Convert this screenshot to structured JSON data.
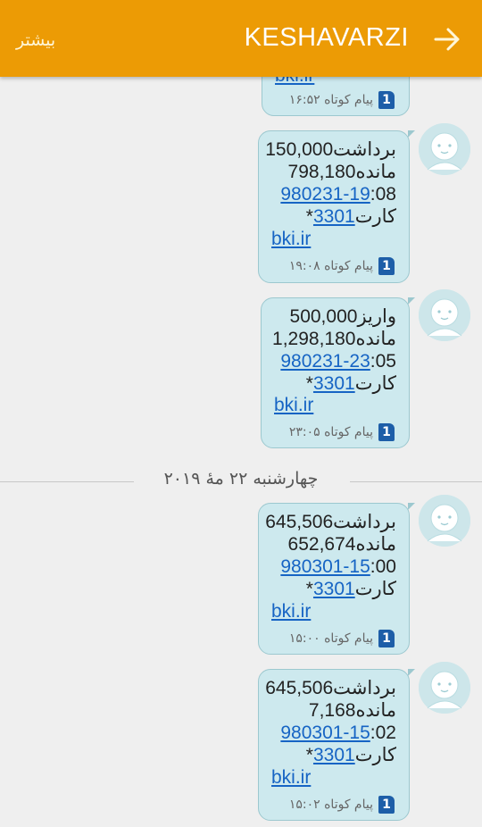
{
  "header": {
    "title": "KESHAVARZI",
    "more_label": "بیشتر",
    "back_icon": "arrow-right-icon"
  },
  "colors": {
    "appbar": "#ec9b05",
    "bubble": "#cde9ee",
    "link": "#1664c4",
    "sim_badge": "#1d5ea8"
  },
  "partial_message": {
    "link_text": "bki.ir",
    "sim": "1",
    "meta": "پیام کوتاه ۱۶:۵۲"
  },
  "date_separator": "چهارشنبه ۲۲ مهٔ ۲۰۱۹",
  "messages": [
    {
      "line1": "برداشت150,000",
      "line2": "مانده798,180",
      "line3_link": "980231-19",
      "line3_rest": ":08",
      "line4_prefix": "کارت",
      "line4_link": "3301",
      "line4_suffix": "*",
      "url": "bki.ir",
      "sim": "1",
      "meta": "پیام کوتاه ۱۹:۰۸"
    },
    {
      "line1": "واریز500,000",
      "line2": "مانده1,298,180",
      "line3_link": "980231-23",
      "line3_rest": ":05",
      "line4_prefix": "کارت",
      "line4_link": "3301",
      "line4_suffix": "*",
      "url": "bki.ir",
      "sim": "1",
      "meta": "پیام کوتاه ۲۳:۰۵"
    },
    {
      "line1": "برداشت645,506",
      "line2": "مانده652,674",
      "line3_link": "980301-15",
      "line3_rest": ":00",
      "line4_prefix": "کارت",
      "line4_link": "3301",
      "line4_suffix": "*",
      "url": "bki.ir",
      "sim": "1",
      "meta": "پیام کوتاه ۱۵:۰۰"
    },
    {
      "line1": "برداشت645,506",
      "line2": "مانده7,168",
      "line3_link": "980301-15",
      "line3_rest": ":02",
      "line4_prefix": "کارت",
      "line4_link": "3301",
      "line4_suffix": "*",
      "url": "bki.ir",
      "sim": "1",
      "meta": "پیام کوتاه ۱۵:۰۲"
    }
  ]
}
